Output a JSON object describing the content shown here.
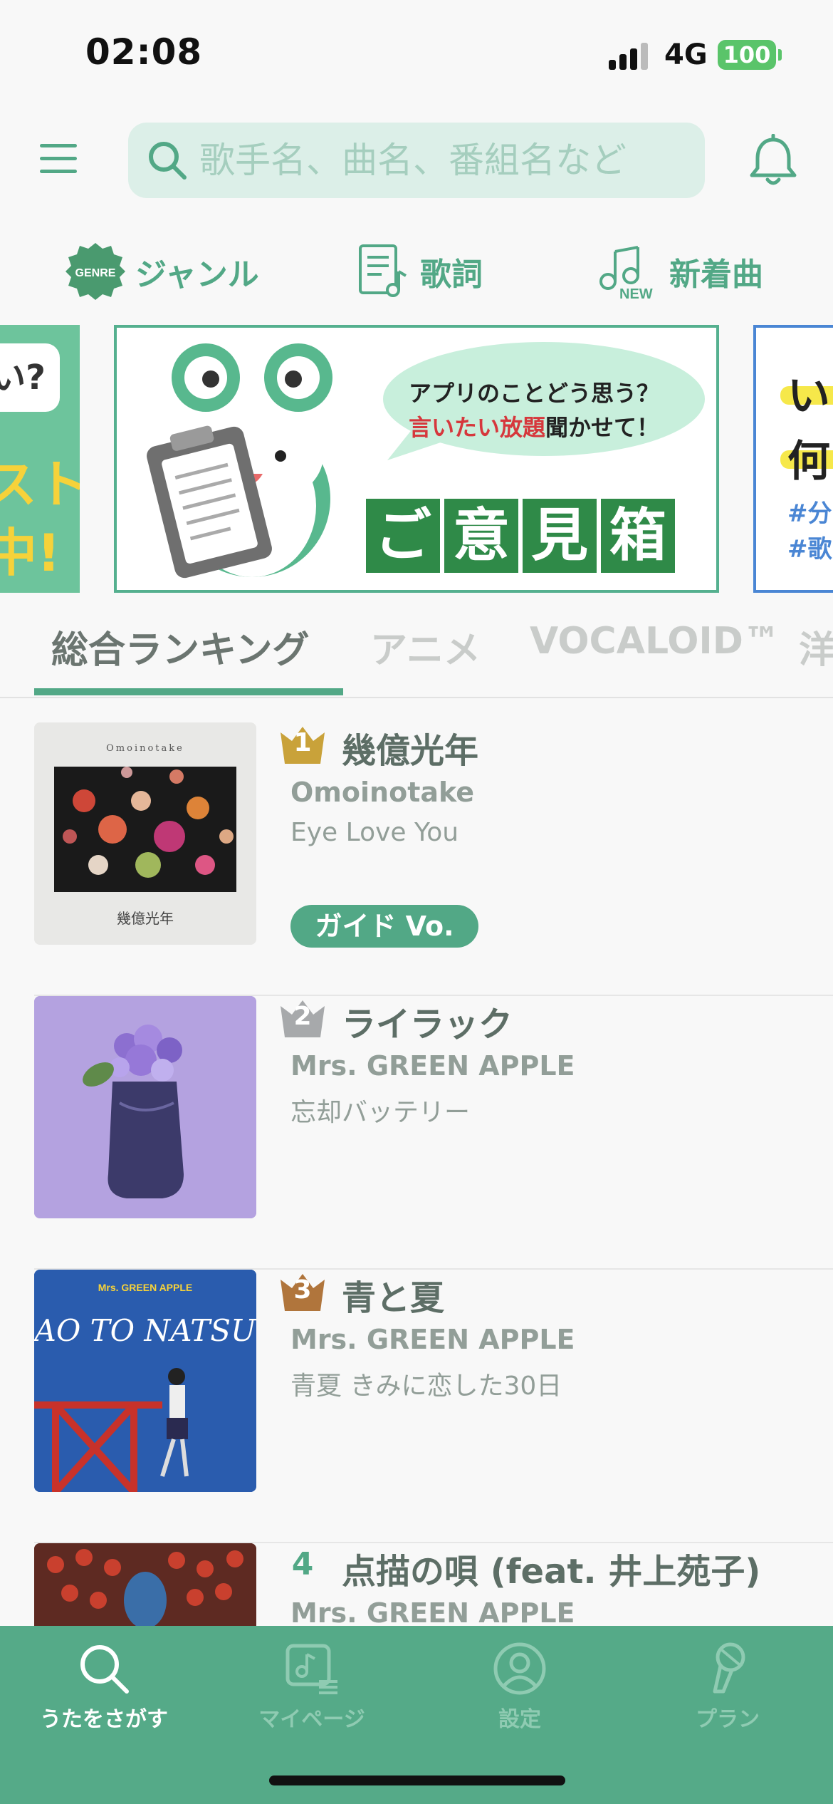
{
  "status_bar": {
    "time": "02:08",
    "network": "4G",
    "battery": "100"
  },
  "search": {
    "placeholder": "歌手名、曲名、番組名など"
  },
  "shortcuts": {
    "genre_badge": "GENRE",
    "genre": "ジャンル",
    "lyrics": "歌詞",
    "new_songs": "新着曲",
    "new_badge": "NEW"
  },
  "banners": {
    "left": {
      "bubble": "い?",
      "text": "スト\n中!"
    },
    "main": {
      "line1": "アプリのことどう思う？",
      "line2_highlight": "言いたい放題",
      "line2_rest": "聞かせて！",
      "title_chars": [
        "ご",
        "意",
        "見",
        "箱"
      ]
    },
    "right": {
      "text": "い\n何",
      "tags": "#分\n#歌"
    }
  },
  "tabs": [
    {
      "label": "総合ランキング",
      "active": true
    },
    {
      "label": "アニメ",
      "active": false
    },
    {
      "label": "VOCALOID™",
      "active": false
    },
    {
      "label": "洋",
      "active": false
    }
  ],
  "ranking": [
    {
      "rank": "1",
      "title": "幾億光年",
      "artist": "Omoinotake",
      "tieup": "Eye Love You",
      "badge": "ガイド Vo.",
      "art_text_top": "Omoinotake",
      "art_text_bottom": "幾億光年"
    },
    {
      "rank": "2",
      "title": "ライラック",
      "artist": "Mrs. GREEN APPLE",
      "tieup": "忘却バッテリー"
    },
    {
      "rank": "3",
      "title": "青と夏",
      "artist": "Mrs. GREEN APPLE",
      "tieup": "青夏 きみに恋した30日",
      "art_text_top": "Mrs. GREEN APPLE",
      "art_text_bottom": "AO TO NATSU"
    },
    {
      "rank": "4",
      "title": "点描の唄 (feat. 井上苑子)",
      "artist": "Mrs. GREEN APPLE",
      "tieup": ""
    }
  ],
  "tabbar": [
    {
      "label": "うたをさがす",
      "icon": "search-icon",
      "active": true
    },
    {
      "label": "マイページ",
      "icon": "music-list-icon",
      "active": false
    },
    {
      "label": "設定",
      "icon": "user-icon",
      "active": false
    },
    {
      "label": "プラン",
      "icon": "microphone-icon",
      "active": false
    }
  ],
  "colors": {
    "accent": "#52a886",
    "tabbar": "#55aa88",
    "search_bg": "#dcefe8",
    "gold": "#c9a23a",
    "silver": "#a7a9ab",
    "bronze": "#b0753c"
  }
}
